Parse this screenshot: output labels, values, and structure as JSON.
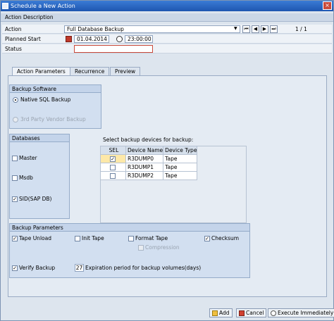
{
  "window": {
    "title": "Schedule a New Action",
    "close_glyph": "×"
  },
  "action_description": {
    "section_title": "Action Description",
    "action_label": "Action",
    "action_value": "Full Database Backup",
    "page_counter": "1 / 1",
    "planned_start_label": "Planned Start",
    "date_value": "01.04.2014",
    "time_value": "23:00:00",
    "status_label": "Status",
    "status_value": ""
  },
  "tabs": [
    "Action Parameters",
    "Recurrence",
    "Preview"
  ],
  "backup_software": {
    "title": "Backup Software",
    "options": [
      {
        "label": "Native SQL Backup",
        "selected": true,
        "enabled": true
      },
      {
        "label": "3rd Party Vendor Backup",
        "selected": false,
        "enabled": false
      }
    ]
  },
  "databases": {
    "title": "Databases",
    "items": [
      {
        "label": "Master",
        "checked": false
      },
      {
        "label": "Msdb",
        "checked": false
      },
      {
        "label": "SID(SAP DB)",
        "checked": true
      }
    ]
  },
  "devices": {
    "prompt": "Select backup devices for backup:",
    "columns": [
      "SEL",
      "Device Name",
      "Device Type"
    ],
    "rows": [
      {
        "sel": true,
        "name": "R3DUMP0",
        "type": "Tape"
      },
      {
        "sel": false,
        "name": "R3DUMP1",
        "type": "Tape"
      },
      {
        "sel": false,
        "name": "R3DUMP2",
        "type": "Tape"
      }
    ]
  },
  "backup_parameters": {
    "title": "Backup Parameters",
    "tape_unload": "Tape Unload",
    "init_tape": "Init Tape",
    "format_tape": "Format Tape",
    "checksum": "Checksum",
    "compression": "Compression",
    "verify_backup": "Verify Backup",
    "expiration_value": "27",
    "expiration_label": "Expiration period for backup volumes(days)"
  },
  "buttons": {
    "add": "Add",
    "cancel": "Cancel",
    "execute": "Execute Immediately"
  },
  "nav_glyphs": {
    "first": "⏮",
    "prev": "◀",
    "next": "▶",
    "last": "⏭",
    "dropdown": "▼",
    "check": "✓"
  }
}
